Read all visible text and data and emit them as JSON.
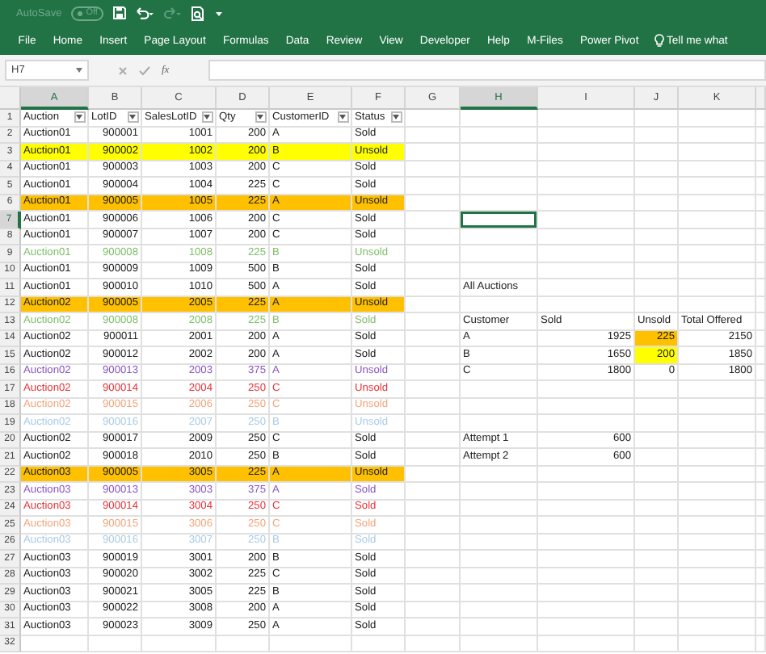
{
  "title_bar": {
    "autosave_label": "AutoSave",
    "autosave_state": "Off",
    "autosave_on": false
  },
  "ribbon_tabs": [
    {
      "label": "File",
      "selected": false
    },
    {
      "label": "Home",
      "selected": false
    },
    {
      "label": "Insert",
      "selected": false
    },
    {
      "label": "Page Layout",
      "selected": false
    },
    {
      "label": "Formulas",
      "selected": false
    },
    {
      "label": "Data",
      "selected": false
    },
    {
      "label": "Review",
      "selected": false
    },
    {
      "label": "View",
      "selected": false
    },
    {
      "label": "Developer",
      "selected": false
    },
    {
      "label": "Help",
      "selected": false
    },
    {
      "label": "M-Files",
      "selected": false
    },
    {
      "label": "Power Pivot",
      "selected": false
    }
  ],
  "tell_me": "Tell me what",
  "formula_bar": {
    "name_box": "H7",
    "fx": "fx"
  },
  "columns": [
    {
      "letter": "A",
      "selected": true
    },
    {
      "letter": "B",
      "selected": false
    },
    {
      "letter": "C",
      "selected": false
    },
    {
      "letter": "D",
      "selected": false
    },
    {
      "letter": "E",
      "selected": false
    },
    {
      "letter": "F",
      "selected": false
    },
    {
      "letter": "G",
      "selected": false
    },
    {
      "letter": "H",
      "selected": true
    },
    {
      "letter": "I",
      "selected": false
    },
    {
      "letter": "J",
      "selected": false
    },
    {
      "letter": "K",
      "selected": false
    }
  ],
  "autofilter": true,
  "rows": [
    {
      "n": "1",
      "selected": false,
      "cells": {
        "A": "Auction",
        "B": "LotID",
        "C": "SalesLotID",
        "D": "Qty",
        "E": "CustomerID",
        "F": "Status"
      }
    },
    {
      "n": "2",
      "selected": false,
      "cells": {
        "A": "Auction01",
        "B": "900001",
        "C": "1001",
        "D": "200",
        "E": "A",
        "F": "Sold"
      }
    },
    {
      "n": "3",
      "selected": false,
      "highlight": {
        "color": "#ffff00"
      },
      "cells": {
        "A": "Auction01",
        "B": "900002",
        "C": "1002",
        "D": "200",
        "E": "B",
        "F": "Unsold"
      }
    },
    {
      "n": "4",
      "selected": false,
      "cells": {
        "A": "Auction01",
        "B": "900003",
        "C": "1003",
        "D": "200",
        "E": "C",
        "F": "Sold"
      }
    },
    {
      "n": "5",
      "selected": false,
      "cells": {
        "A": "Auction01",
        "B": "900004",
        "C": "1004",
        "D": "225",
        "E": "C",
        "F": "Sold"
      }
    },
    {
      "n": "6",
      "selected": false,
      "highlight": {
        "color": "#ffc000"
      },
      "cells": {
        "A": "Auction01",
        "B": "900005",
        "C": "1005",
        "D": "225",
        "E": "A",
        "F": "Unsold"
      }
    },
    {
      "n": "7",
      "selected": true,
      "cells": {
        "A": "Auction01",
        "B": "900006",
        "C": "1006",
        "D": "200",
        "E": "C",
        "F": "Sold",
        "H": {
          "selected": true
        }
      }
    },
    {
      "n": "8",
      "selected": false,
      "cells": {
        "A": "Auction01",
        "B": "900007",
        "C": "1007",
        "D": "200",
        "E": "C",
        "F": "Sold"
      }
    },
    {
      "n": "9",
      "selected": false,
      "font": {
        "color": "#7fbf6a"
      },
      "cells": {
        "A": "Auction01",
        "B": "900008",
        "C": "1008",
        "D": "225",
        "E": "B",
        "F": "Unsold"
      }
    },
    {
      "n": "10",
      "selected": false,
      "cells": {
        "A": "Auction01",
        "B": "900009",
        "C": "1009",
        "D": "500",
        "E": "B",
        "F": "Sold"
      }
    },
    {
      "n": "11",
      "selected": false,
      "cells": {
        "A": "Auction01",
        "B": "900010",
        "C": "1010",
        "D": "500",
        "E": "A",
        "F": "Sold",
        "H": "All Auctions"
      }
    },
    {
      "n": "12",
      "selected": false,
      "highlight": {
        "color": "#ffc000"
      },
      "cells": {
        "A": "Auction02",
        "B": "900005",
        "C": "2005",
        "D": "225",
        "E": "A",
        "F": "Unsold"
      }
    },
    {
      "n": "13",
      "selected": false,
      "font": {
        "color": "#7fbf6a"
      },
      "cells": {
        "A": "Auction02",
        "B": "900008",
        "C": "2008",
        "D": "225",
        "E": "B",
        "F": "Sold",
        "H": "Customer",
        "I": "Sold",
        "J": "Unsold",
        "K": "Total Offered"
      }
    },
    {
      "n": "14",
      "selected": false,
      "cells": {
        "A": "Auction02",
        "B": "900011",
        "C": "2001",
        "D": "200",
        "E": "A",
        "F": "Sold",
        "H": "A",
        "I": "1925",
        "J": {
          "text": "225",
          "highlight": {
            "color": "#ffc000"
          }
        },
        "K": "2150"
      }
    },
    {
      "n": "15",
      "selected": false,
      "cells": {
        "A": "Auction02",
        "B": "900012",
        "C": "2002",
        "D": "200",
        "E": "A",
        "F": "Sold",
        "H": "B",
        "I": "1650",
        "J": {
          "text": "200",
          "highlight": {
            "color": "#ffff00"
          }
        },
        "K": "1850"
      }
    },
    {
      "n": "16",
      "selected": false,
      "font": {
        "color": "#8a55c4"
      },
      "cells": {
        "A": "Auction02",
        "B": "900013",
        "C": "2003",
        "D": "375",
        "E": "A",
        "F": "Unsold",
        "H": "C",
        "I": "1800",
        "J": "0",
        "K": "1800"
      }
    },
    {
      "n": "17",
      "selected": false,
      "font": {
        "color": "#e8343a"
      },
      "cells": {
        "A": "Auction02",
        "B": "900014",
        "C": "2004",
        "D": "250",
        "E": "C",
        "F": "Unsold"
      }
    },
    {
      "n": "18",
      "selected": false,
      "font": {
        "color": "#f4a47a"
      },
      "cells": {
        "A": "Auction02",
        "B": "900015",
        "C": "2006",
        "D": "250",
        "E": "C",
        "F": "Unsold"
      }
    },
    {
      "n": "19",
      "selected": false,
      "font": {
        "color": "#a9cbe8"
      },
      "cells": {
        "A": "Auction02",
        "B": "900016",
        "C": "2007",
        "D": "250",
        "E": "B",
        "F": "Unsold"
      }
    },
    {
      "n": "20",
      "selected": false,
      "cells": {
        "A": "Auction02",
        "B": "900017",
        "C": "2009",
        "D": "250",
        "E": "C",
        "F": "Sold",
        "H": "Attempt 1",
        "I": "600"
      }
    },
    {
      "n": "21",
      "selected": false,
      "cells": {
        "A": "Auction02",
        "B": "900018",
        "C": "2010",
        "D": "250",
        "E": "B",
        "F": "Sold",
        "H": "Attempt 2",
        "I": "600"
      }
    },
    {
      "n": "22",
      "selected": false,
      "highlight": {
        "color": "#ffc000"
      },
      "cells": {
        "A": "Auction03",
        "B": "900005",
        "C": "3005",
        "D": "225",
        "E": "A",
        "F": "Unsold"
      }
    },
    {
      "n": "23",
      "selected": false,
      "font": {
        "color": "#8a55c4"
      },
      "cells": {
        "A": "Auction03",
        "B": "900013",
        "C": "3003",
        "D": "375",
        "E": "A",
        "F": "Sold"
      }
    },
    {
      "n": "24",
      "selected": false,
      "font": {
        "color": "#e8343a"
      },
      "cells": {
        "A": "Auction03",
        "B": "900014",
        "C": "3004",
        "D": "250",
        "E": "C",
        "F": "Sold"
      }
    },
    {
      "n": "25",
      "selected": false,
      "font": {
        "color": "#f4a47a"
      },
      "cells": {
        "A": "Auction03",
        "B": "900015",
        "C": "3006",
        "D": "250",
        "E": "C",
        "F": "Sold"
      }
    },
    {
      "n": "26",
      "selected": false,
      "font": {
        "color": "#a9cbe8"
      },
      "cells": {
        "A": "Auction03",
        "B": "900016",
        "C": "3007",
        "D": "250",
        "E": "B",
        "F": "Sold"
      }
    },
    {
      "n": "27",
      "selected": false,
      "cells": {
        "A": "Auction03",
        "B": "900019",
        "C": "3001",
        "D": "200",
        "E": "B",
        "F": "Sold"
      }
    },
    {
      "n": "28",
      "selected": false,
      "cells": {
        "A": "Auction03",
        "B": "900020",
        "C": "3002",
        "D": "225",
        "E": "C",
        "F": "Sold"
      }
    },
    {
      "n": "29",
      "selected": false,
      "cells": {
        "A": "Auction03",
        "B": "900021",
        "C": "3005",
        "D": "225",
        "E": "B",
        "F": "Sold"
      }
    },
    {
      "n": "30",
      "selected": false,
      "cells": {
        "A": "Auction03",
        "B": "900022",
        "C": "3008",
        "D": "200",
        "E": "A",
        "F": "Sold"
      }
    },
    {
      "n": "31",
      "selected": false,
      "cells": {
        "A": "Auction03",
        "B": "900023",
        "C": "3009",
        "D": "250",
        "E": "A",
        "F": "Sold"
      }
    },
    {
      "n": "32",
      "selected": false
    }
  ]
}
